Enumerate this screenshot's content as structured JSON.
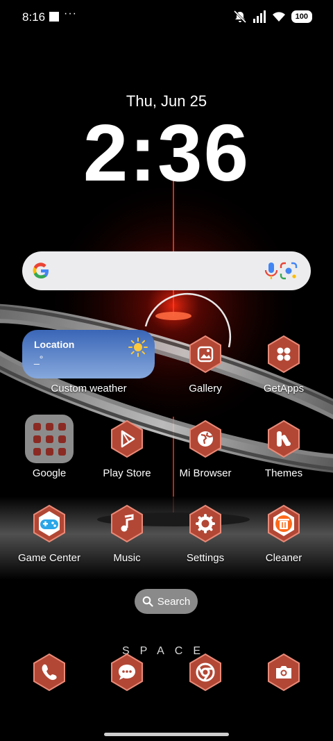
{
  "status_bar": {
    "time": "8:16",
    "overflow": "···",
    "battery": "100"
  },
  "clock": {
    "date": "Thu, Jun 25",
    "time": "2:36"
  },
  "weather": {
    "location": "Location",
    "temp": "_°",
    "label": "Custom weather"
  },
  "search_pill": {
    "label": "Search"
  },
  "wallpaper_text": "SPACE",
  "apps": {
    "gallery": "Gallery",
    "getapps": "GetApps",
    "google": "Google",
    "playstore": "Play Store",
    "mibrowser": "Mi Browser",
    "themes": "Themes",
    "gamecenter": "Game Center",
    "music": "Music",
    "settings": "Settings",
    "cleaner": "Cleaner"
  },
  "dock": [
    "phone-icon",
    "messages-icon",
    "chrome-icon",
    "camera-icon"
  ],
  "colors": {
    "icon_red": "#b24735",
    "icon_dark": "#7a2519",
    "glow": "#ff2a10"
  }
}
